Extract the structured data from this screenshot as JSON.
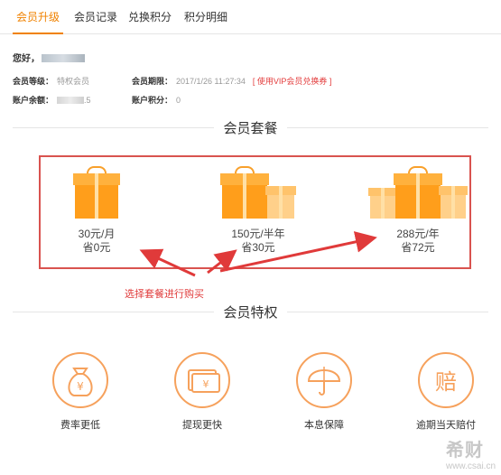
{
  "tabs": [
    {
      "label": "会员升级",
      "active": true
    },
    {
      "label": "会员记录",
      "active": false
    },
    {
      "label": "兑换积分",
      "active": false
    },
    {
      "label": "积分明细",
      "active": false
    }
  ],
  "account": {
    "greeting": "您好，",
    "level_label": "会员等级：",
    "level_value": "特权会员",
    "expiry_label": "会员期限：",
    "expiry_value": "2017/1/26 11:27:34",
    "expiry_link": "[ 使用VIP会员兑换券 ]",
    "balance_label": "账户余额：",
    "balance_value": ".5",
    "points_label": "账户积分：",
    "points_value": "0"
  },
  "packages_section": {
    "title": "会员套餐",
    "items": [
      {
        "price": "30元/月",
        "saving": "省0元"
      },
      {
        "price": "150元/半年",
        "saving": "省30元"
      },
      {
        "price": "288元/年",
        "saving": "省72元"
      }
    ],
    "hint": "选择套餐进行购买"
  },
  "privileges_section": {
    "title": "会员特权",
    "items": [
      {
        "label": "费率更低",
        "icon": "money-bag-icon"
      },
      {
        "label": "提现更快",
        "icon": "cash-icon"
      },
      {
        "label": "本息保障",
        "icon": "umbrella-icon"
      },
      {
        "label": "逾期当天赔付",
        "icon": "compensation-icon"
      }
    ]
  },
  "watermark": {
    "text": "希财",
    "url": "www.csai.cn"
  },
  "colors": {
    "accent": "#f08200",
    "warn": "#e33c3c",
    "gift": "#ff9e1b",
    "privilege_ring": "#f6a15c"
  }
}
